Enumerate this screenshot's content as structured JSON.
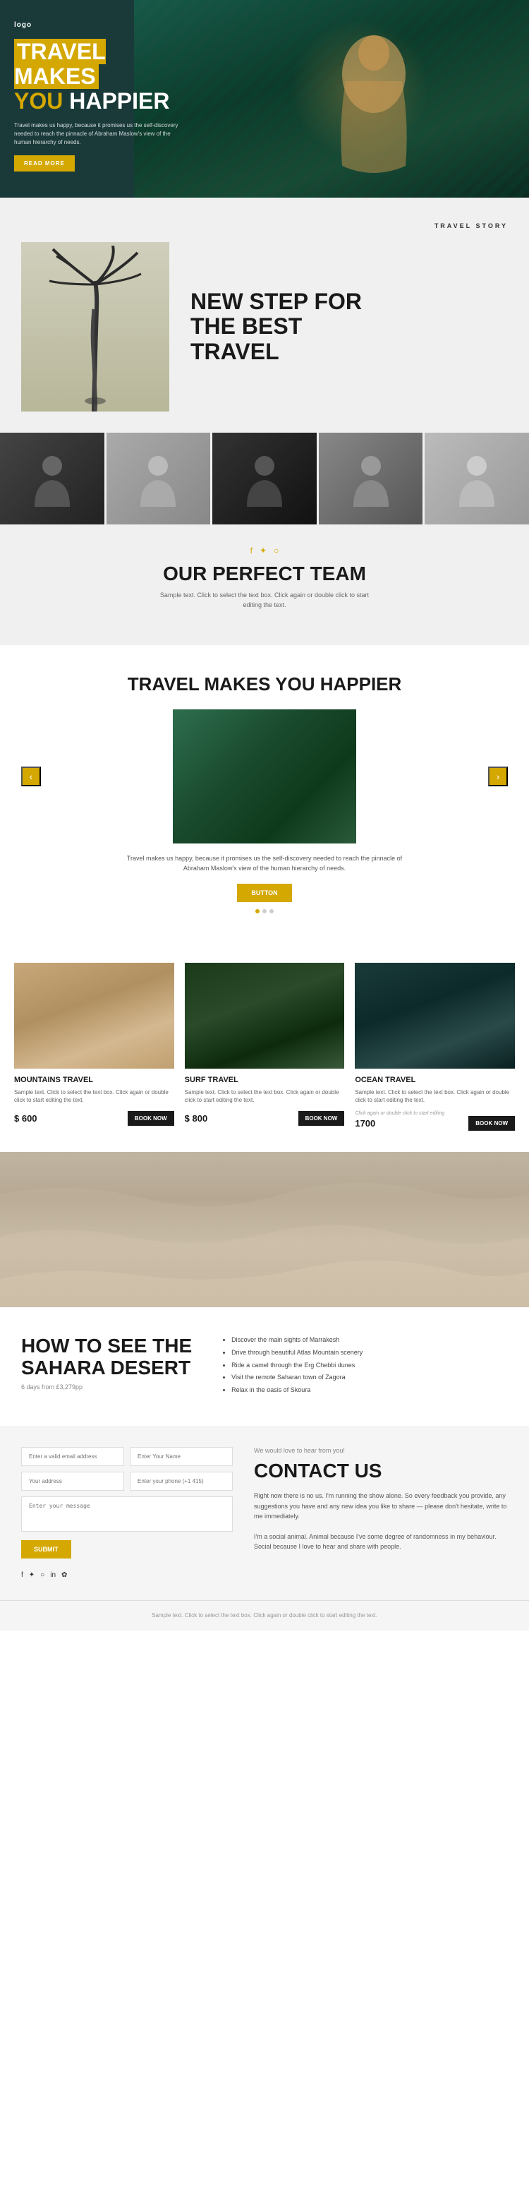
{
  "logo": {
    "text": "logo"
  },
  "hero": {
    "title_line1": "TRAVEL MAKES",
    "title_line2": "YOU HAPPIER",
    "description": "Travel makes us happy, because it promises us the self-discovery needed to reach the pinnacle of Abraham Maslow's view of the human hierarchy of needs.",
    "btn_label": "READ MORE"
  },
  "travel_story": {
    "tag": "TRAVEL STORY",
    "title_line1": "NEW STEP FOR",
    "title_line2": "THE BEST",
    "title_line3": "TRAVEL"
  },
  "team": {
    "title": "OUR PERFECT TEAM",
    "description": "Sample text. Click to select the text box. Click again or double click to start editing the text.",
    "social": [
      "f",
      "✦",
      "○"
    ]
  },
  "slider": {
    "title": "TRAVEL MAKES YOU HAPPIER",
    "description": "Travel makes us happy, because it promises us the self-discovery needed to reach the pinnacle of Abraham Maslow's view of the human hierarchy of needs.",
    "btn_label": "Button",
    "arrow_left": "‹",
    "arrow_right": "›"
  },
  "cards": [
    {
      "type": "mountains",
      "title": "MOUNTAINS TRAVEL",
      "text": "Sample text. Click to select the text box. Click again or double click to start editing the text.",
      "price": "$ 600",
      "btn": "BOOK NOW"
    },
    {
      "type": "surf",
      "title": "SURF TRAVEL",
      "text": "Sample text. Click to select the text box. Click again or double click to start editing the text.",
      "price": "$ 800",
      "btn": "BOOK NOW"
    },
    {
      "type": "ocean",
      "title": "OCEAN TRAVEL",
      "edit_note": "Click again or double click to start editing",
      "text": "Sample text. Click to select the text box. Click again or double click to start editing the text.",
      "price": "1700",
      "btn": "BOOK NOW"
    }
  ],
  "sahara": {
    "title_line1": "HOW TO SEE THE",
    "title_line2": "SAHARA DESERT",
    "subtitle": "6 days from £3,279pp",
    "list": [
      "Discover the main sights of Marrakesh",
      "Drive through beautiful Atlas Mountain scenery",
      "Ride a camel through the Erg Chebbi dunes",
      "Visit the remote Saharan town of Zagora",
      "Relax in the oasis of Skoura"
    ]
  },
  "contact": {
    "tagline": "We would love to hear from you!",
    "title": "CONTACT US",
    "description": "Right now there is no us. I'm running the show alone. So every feedback you provide, any suggestions you have and any new idea you like to share — please don't hesitate, write to me immediately.\n\nI'm a social animal. Animal because I've some degree of randomness in my behaviour. Social because I love to hear and share with people.",
    "form": {
      "email_placeholder": "Enter a valid email address",
      "name_placeholder": "Enter Your Name",
      "address_placeholder": "Your address",
      "phone_placeholder": "Enter your phone (+1 415)",
      "message_placeholder": "Enter your message",
      "submit_label": "Submit"
    },
    "social_icons": [
      "f",
      "✦",
      "○",
      "in",
      "✿"
    ]
  },
  "footer": {
    "text": "Sample text. Click to select the text box. Click again or double click to start editing the text."
  }
}
